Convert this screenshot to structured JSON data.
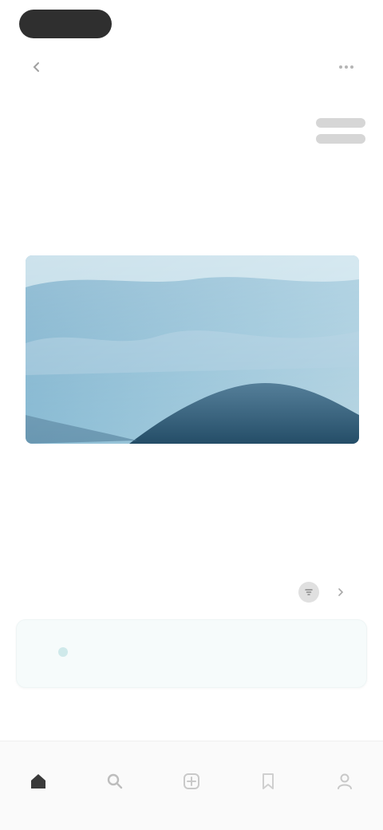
{
  "app": {
    "title_pill": "",
    "mini_left": "",
    "mini_right": ""
  },
  "header": {
    "title": "",
    "subtitle": ""
  },
  "gallery": {
    "section_label": "",
    "caption": "",
    "caption_sub": ""
  },
  "activity": {
    "title": "",
    "card_text": ""
  },
  "nav": {
    "items": [
      {
        "icon": "home-icon",
        "label": ""
      },
      {
        "icon": "search-icon",
        "label": ""
      },
      {
        "icon": "plus-icon",
        "label": ""
      },
      {
        "icon": "bookmark-icon",
        "label": ""
      },
      {
        "icon": "profile-icon",
        "label": ""
      }
    ]
  },
  "colors": {
    "hero_sky": "#6ea8c6",
    "hero_mountain": "#2f5f7d",
    "accent": "#6bbcc0"
  }
}
